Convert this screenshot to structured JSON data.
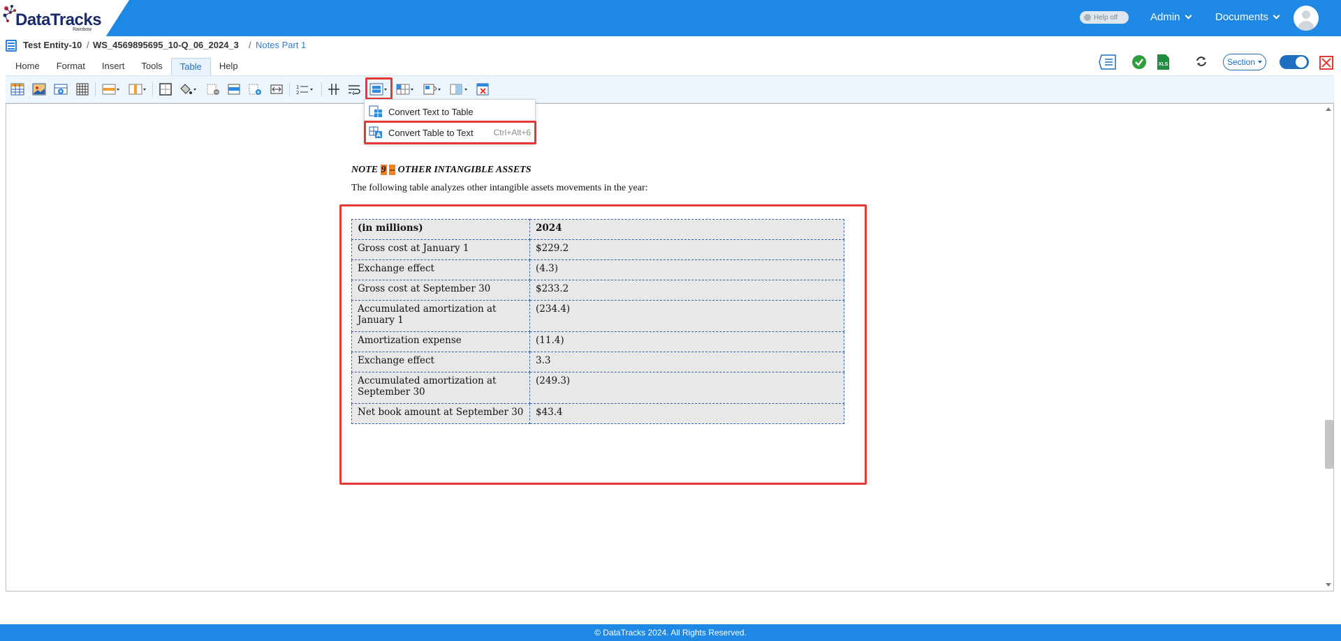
{
  "brand": {
    "name": "DataTracks",
    "sub": "Rainbow",
    "accent": "#1e88e5"
  },
  "header": {
    "help_toggle": "Help off",
    "admin": "Admin",
    "documents": "Documents"
  },
  "breadcrumb": {
    "entity": "Test Entity-10",
    "workspace": "WS_4569895695_10-Q_06_2024_3",
    "section": "Notes Part 1"
  },
  "tabs": [
    {
      "label": "Home"
    },
    {
      "label": "Format"
    },
    {
      "label": "Insert"
    },
    {
      "label": "Tools"
    },
    {
      "label": "Table"
    },
    {
      "label": "Help"
    }
  ],
  "active_tab": "Table",
  "right_tools": {
    "section_label": "Section"
  },
  "dropdown": {
    "items": [
      {
        "label": "Convert Text to Table",
        "shortcut": ""
      },
      {
        "label": "Convert Table to Text",
        "shortcut": "Ctrl+Alt+6"
      }
    ]
  },
  "document": {
    "note_prefix": "NOTE ",
    "note_number": "9",
    "note_dash": "–",
    "note_title": " OTHER INTANGIBLE ASSETS",
    "intro": "The following table analyzes other intangible assets movements in the year:",
    "table": {
      "header": [
        "(in millions)",
        "2024"
      ],
      "rows": [
        [
          "Gross cost at January 1",
          "$229.2"
        ],
        [
          "Exchange effect",
          "(4.3)"
        ],
        [
          "Gross cost at September 30",
          "$233.2"
        ],
        [
          "Accumulated amortization at January 1",
          "(234.4)"
        ],
        [
          "Amortization expense",
          "(11.4)"
        ],
        [
          "Exchange effect",
          "3.3"
        ],
        [
          "Accumulated amortization at September 30",
          "(249.3)"
        ],
        [
          "Net book amount at September 30",
          "$43.4"
        ]
      ]
    }
  },
  "footer": {
    "text": "© DataTracks 2024. All Rights Reserved."
  }
}
